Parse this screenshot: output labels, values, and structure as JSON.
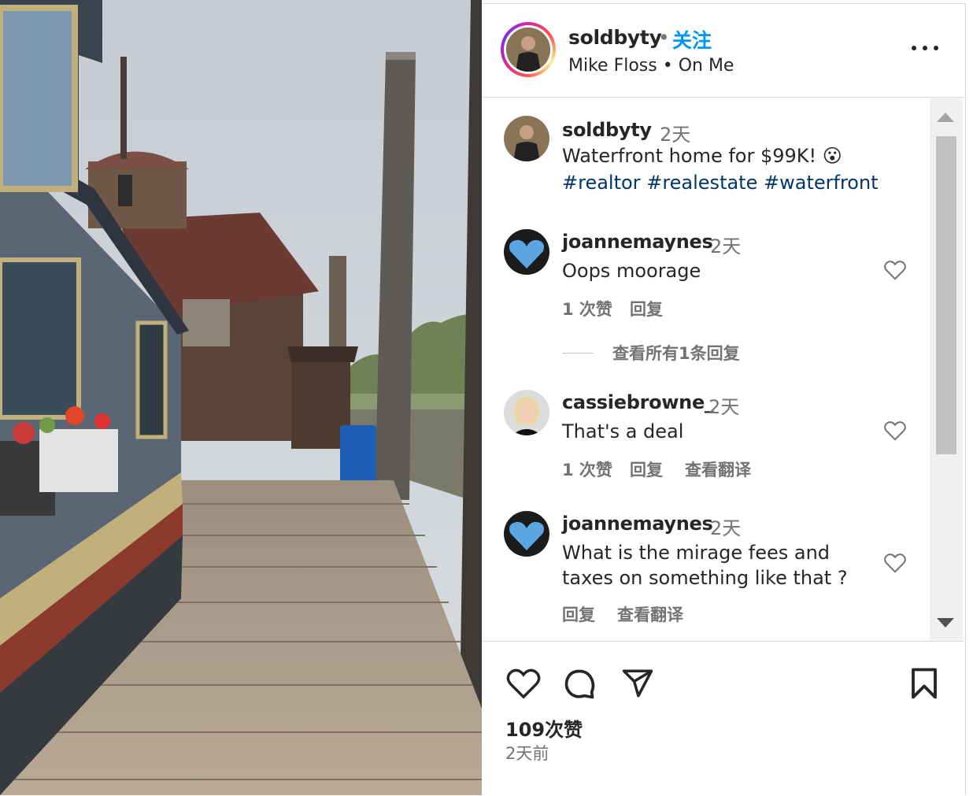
{
  "header": {
    "username": "soldbyty",
    "separator": "•",
    "follow_label": "关注",
    "audio": "Mike Floss • On Me"
  },
  "caption": {
    "username": "soldbyty",
    "time": "2天",
    "text": "Waterfront home for $99K!",
    "emoji": "😮",
    "hashtags": [
      "#realtor",
      "#realestate",
      "#waterfront"
    ]
  },
  "comments": [
    {
      "username": "joannemaynes",
      "time": "2天",
      "text_lines": [
        "Oops moorage"
      ],
      "likes": "1 次赞",
      "reply": "回复",
      "translate": "",
      "view_replies": "查看所有1条回复"
    },
    {
      "username": "cassiebrowne_",
      "time": "2天",
      "text_lines": [
        "That's a deal"
      ],
      "likes": "1 次赞",
      "reply": "回复",
      "translate": "查看翻译",
      "view_replies": ""
    },
    {
      "username": "joannemaynes",
      "time": "2天",
      "text_lines": [
        "What is the mirage fees and",
        "taxes on something like that ?"
      ],
      "likes": "",
      "reply": "回复",
      "translate": "查看翻译",
      "view_replies": ""
    }
  ],
  "footer": {
    "likes": "109次赞",
    "posted": "2天前"
  },
  "icons": {
    "more": "more-horizontal-icon",
    "like": "heart-icon",
    "comment": "comment-icon",
    "share": "send-icon",
    "save": "bookmark-icon"
  },
  "colors": {
    "link_blue": "#0095f6",
    "hashtag": "#00376b",
    "secondary_text": "#737373"
  }
}
